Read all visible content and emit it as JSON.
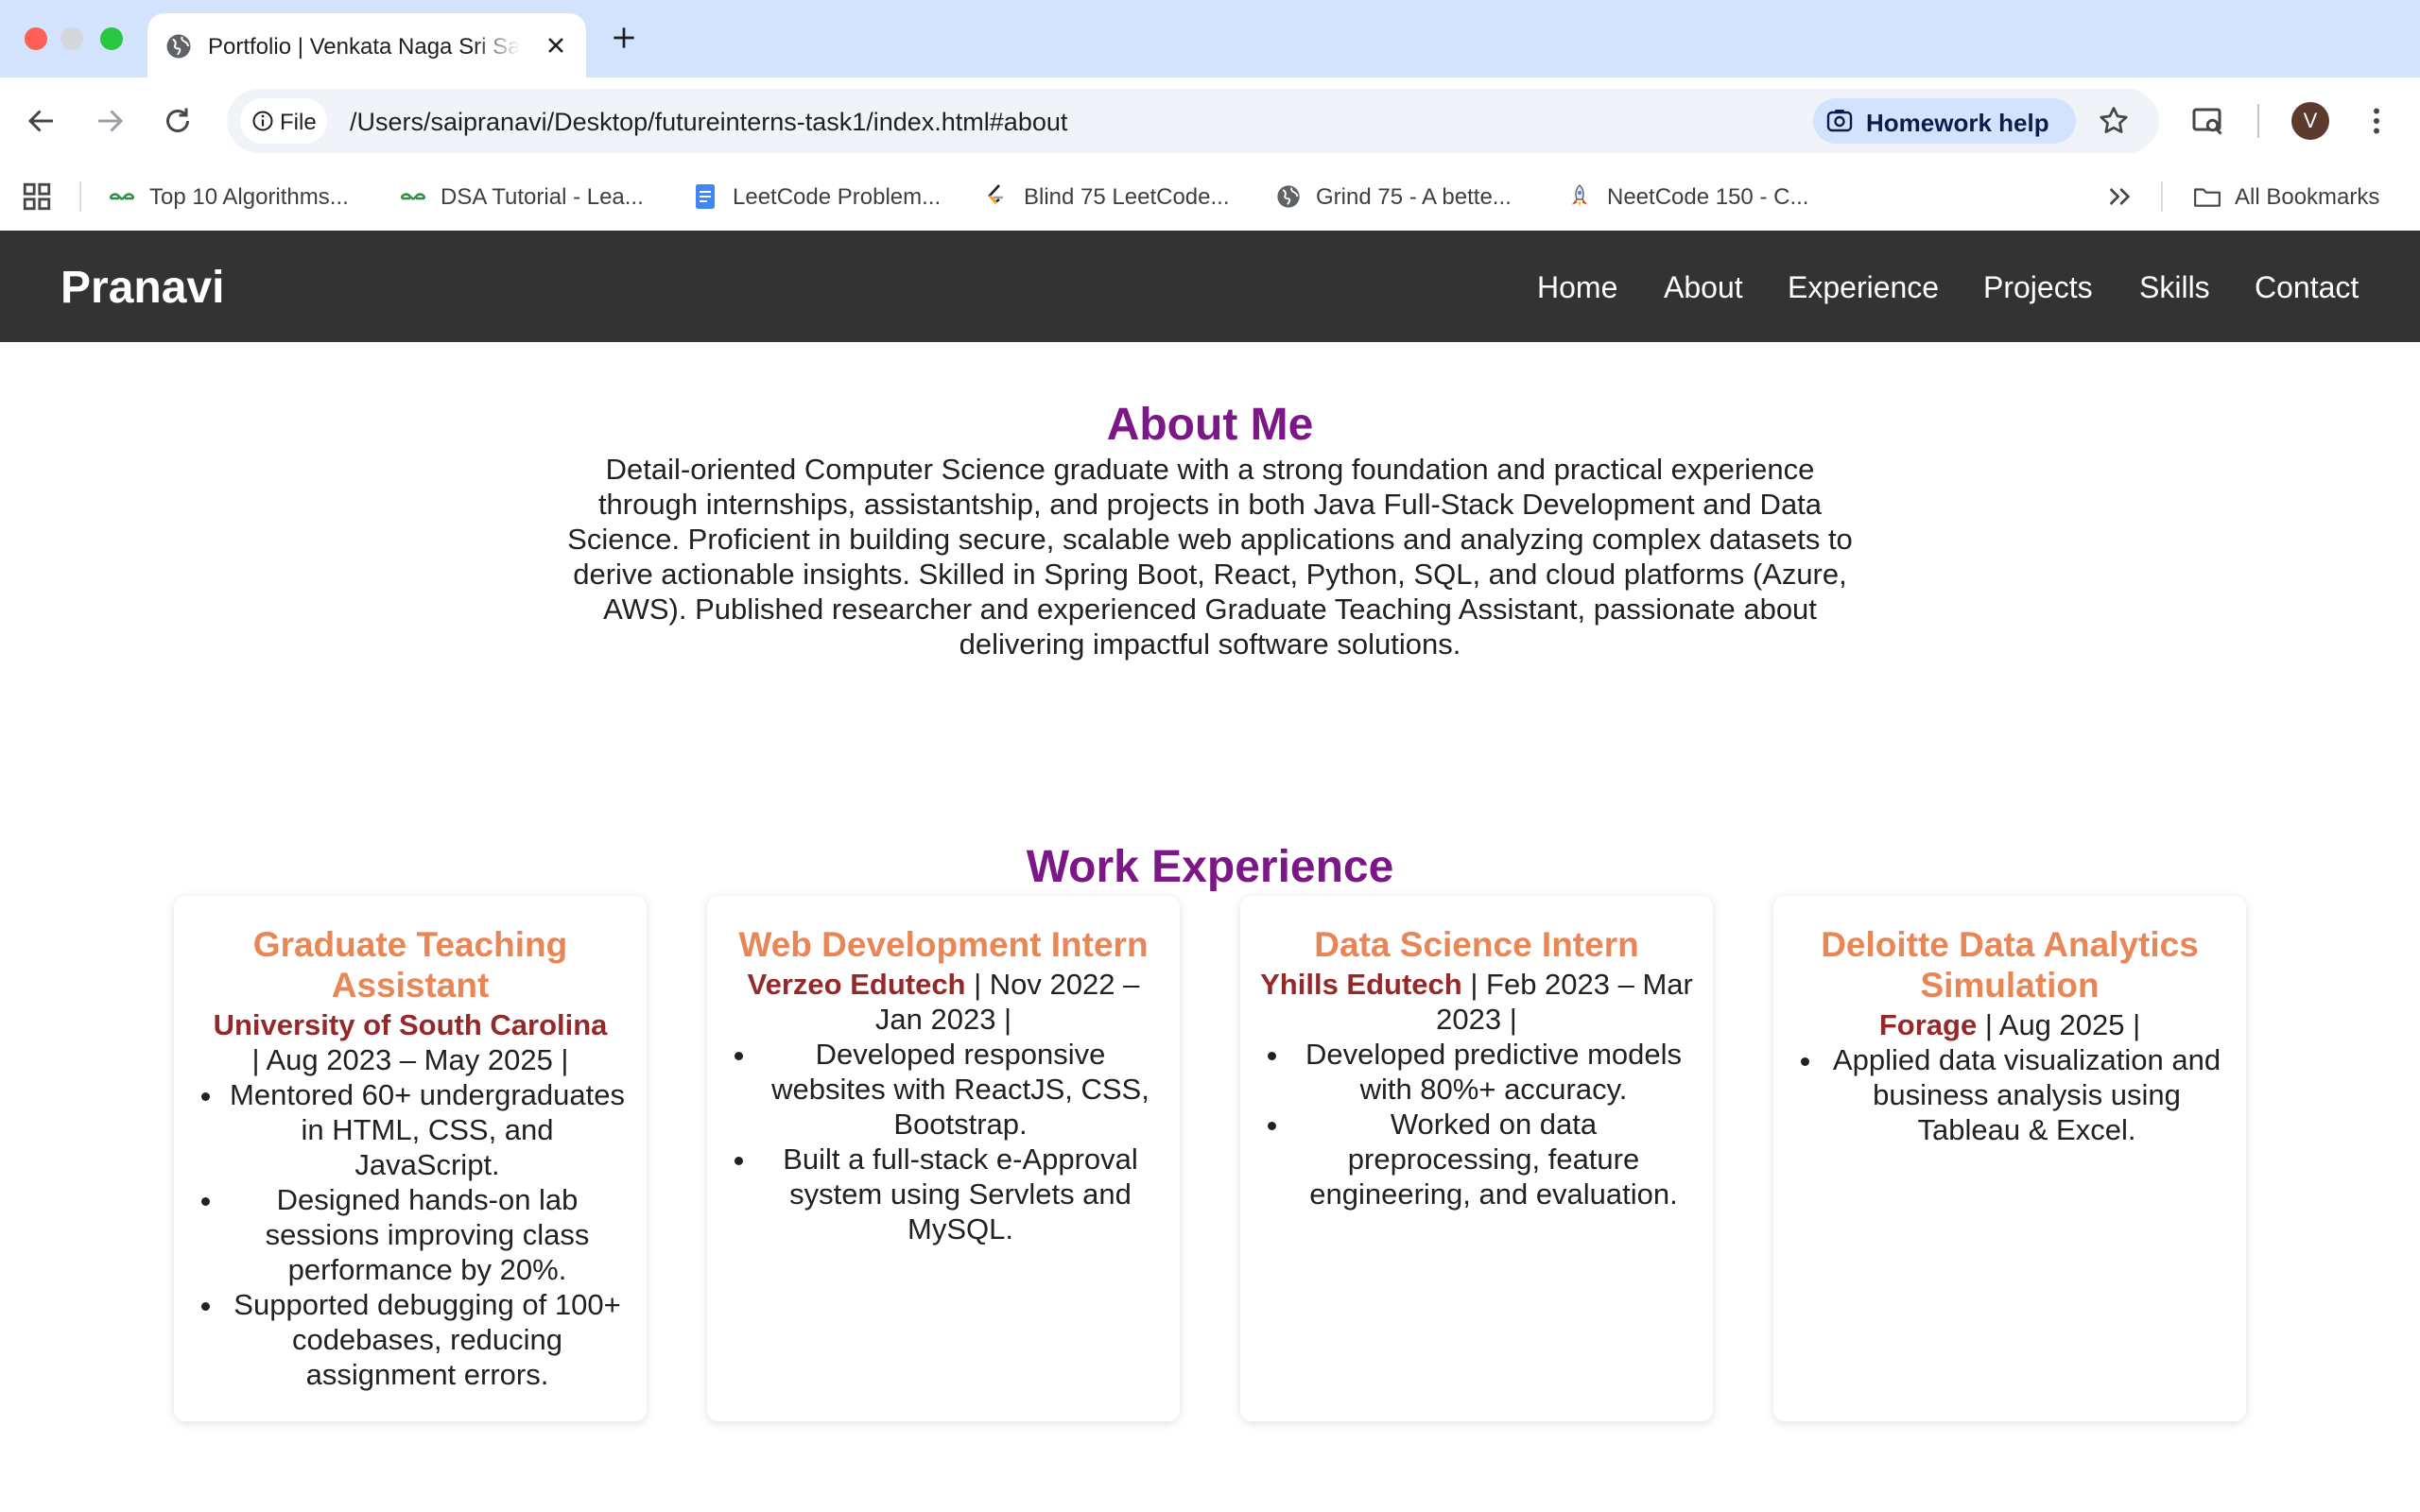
{
  "browser": {
    "tab_title": "Portfolio | Venkata Naga Sri Sai Pranavi",
    "site_chip": "File",
    "url": "/Users/saipranavi/Desktop/futureinterns-task1/index.html#about",
    "homework_help": "Homework help",
    "profile_initial": "V",
    "bookmarks": [
      {
        "label": "Top 10 Algorithms...",
        "icon": "geeksforgeeks-icon"
      },
      {
        "label": "DSA Tutorial - Lea...",
        "icon": "geeksforgeeks-icon"
      },
      {
        "label": "LeetCode Problem...",
        "icon": "google-docs-icon"
      },
      {
        "label": "Blind 75 LeetCode...",
        "icon": "leetcode-icon"
      },
      {
        "label": "Grind 75 - A bette...",
        "icon": "globe-icon"
      },
      {
        "label": "NeetCode 150 - C...",
        "icon": "rocket-icon"
      }
    ],
    "all_bookmarks": "All Bookmarks",
    "colors": {
      "tabstrip": "#d3e3fd",
      "omnibox": "#f0f4f9"
    }
  },
  "site": {
    "brand": "Pranavi",
    "nav": [
      "Home",
      "About",
      "Experience",
      "Projects",
      "Skills",
      "Contact"
    ],
    "colors": {
      "navbar": "#333333",
      "heading": "#7b1786",
      "card_title": "#e88656",
      "company": "#952828"
    }
  },
  "about": {
    "title": "About Me",
    "text": "Detail-oriented Computer Science graduate with a strong foundation and practical experience through internships, assistantship, and projects in both Java Full-Stack Development and Data Science. Proficient in building secure, scalable web applications and analyzing complex datasets to derive actionable insights. Skilled in Spring Boot, React, Python, SQL, and cloud platforms (Azure, AWS). Published researcher and experienced Graduate Teaching Assistant, passionate about delivering impactful software solutions."
  },
  "experience": {
    "title": "Work Experience",
    "cards": [
      {
        "title": "Graduate Teaching Assistant",
        "company": "University of South Carolina",
        "dates": "| Aug 2023 – May 2025 |",
        "bullets": [
          "Mentored 60+ undergraduates in HTML, CSS, and JavaScript.",
          "Designed hands-on lab sessions improving class performance by 20%.",
          "Supported debugging of 100+ codebases, reducing assignment errors."
        ]
      },
      {
        "title": "Web Development Intern",
        "company": "Verzeo Edutech",
        "dates": "| Nov 2022 – Jan 2023 |",
        "bullets": [
          "Developed responsive websites with ReactJS, CSS, Bootstrap.",
          "Built a full-stack e-Approval system using Servlets and MySQL."
        ]
      },
      {
        "title": "Data Science Intern",
        "company": "Yhills Edutech",
        "dates": "| Feb 2023 – Mar 2023 |",
        "bullets": [
          "Developed predictive models with 80%+ accuracy.",
          "Worked on data preprocessing, feature engineering, and evaluation."
        ]
      },
      {
        "title": "Deloitte Data Analytics Simulation",
        "company": "Forage",
        "dates": "| Aug 2025 |",
        "bullets": [
          "Applied data visualization and business analysis using Tableau & Excel."
        ]
      }
    ]
  }
}
